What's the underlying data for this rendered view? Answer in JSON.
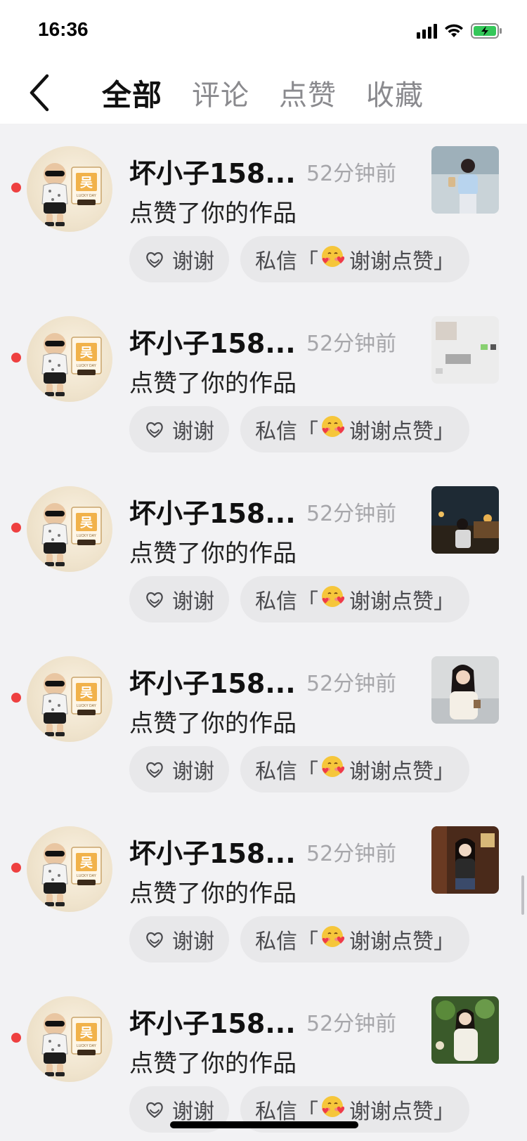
{
  "status_bar": {
    "time": "16:36"
  },
  "tabs": [
    {
      "label": "全部",
      "active": true
    },
    {
      "label": "评论",
      "active": false
    },
    {
      "label": "点赞",
      "active": false
    },
    {
      "label": "收藏",
      "active": false
    }
  ],
  "notifications": [
    {
      "username": "坏小子158...",
      "time": "52分钟前",
      "action": "点赞了你的作品",
      "thanks_label": "谢谢",
      "dm_prefix": "私信「",
      "dm_text": "谢谢点赞」",
      "unread": true
    },
    {
      "username": "坏小子158...",
      "time": "52分钟前",
      "action": "点赞了你的作品",
      "thanks_label": "谢谢",
      "dm_prefix": "私信「",
      "dm_text": "谢谢点赞」",
      "unread": true
    },
    {
      "username": "坏小子158...",
      "time": "52分钟前",
      "action": "点赞了你的作品",
      "thanks_label": "谢谢",
      "dm_prefix": "私信「",
      "dm_text": "谢谢点赞」",
      "unread": true
    },
    {
      "username": "坏小子158...",
      "time": "52分钟前",
      "action": "点赞了你的作品",
      "thanks_label": "谢谢",
      "dm_prefix": "私信「",
      "dm_text": "谢谢点赞」",
      "unread": true
    },
    {
      "username": "坏小子158...",
      "time": "52分钟前",
      "action": "点赞了你的作品",
      "thanks_label": "谢谢",
      "dm_prefix": "私信「",
      "dm_text": "谢谢点赞」",
      "unread": true
    },
    {
      "username": "坏小子158...",
      "time": "52分钟前",
      "action": "点赞了你的作品",
      "thanks_label": "谢谢",
      "dm_prefix": "私信「",
      "dm_text": "谢谢点赞」",
      "unread": true
    }
  ],
  "avatar_badge": {
    "char": "吴",
    "tag_line": "LUCKY DAY"
  },
  "icons": {
    "back": "chevron-left-icon",
    "thanks": "heart-hand-icon",
    "dm_emoji": "blushing-heart-emoji-icon",
    "signal": "signal-icon",
    "wifi": "wifi-icon",
    "battery": "battery-charging-icon"
  },
  "colors": {
    "unread_dot": "#ee4040",
    "battery_fill": "#34c759",
    "background": "#f2f2f4",
    "button_bg": "#e8e8ea"
  }
}
